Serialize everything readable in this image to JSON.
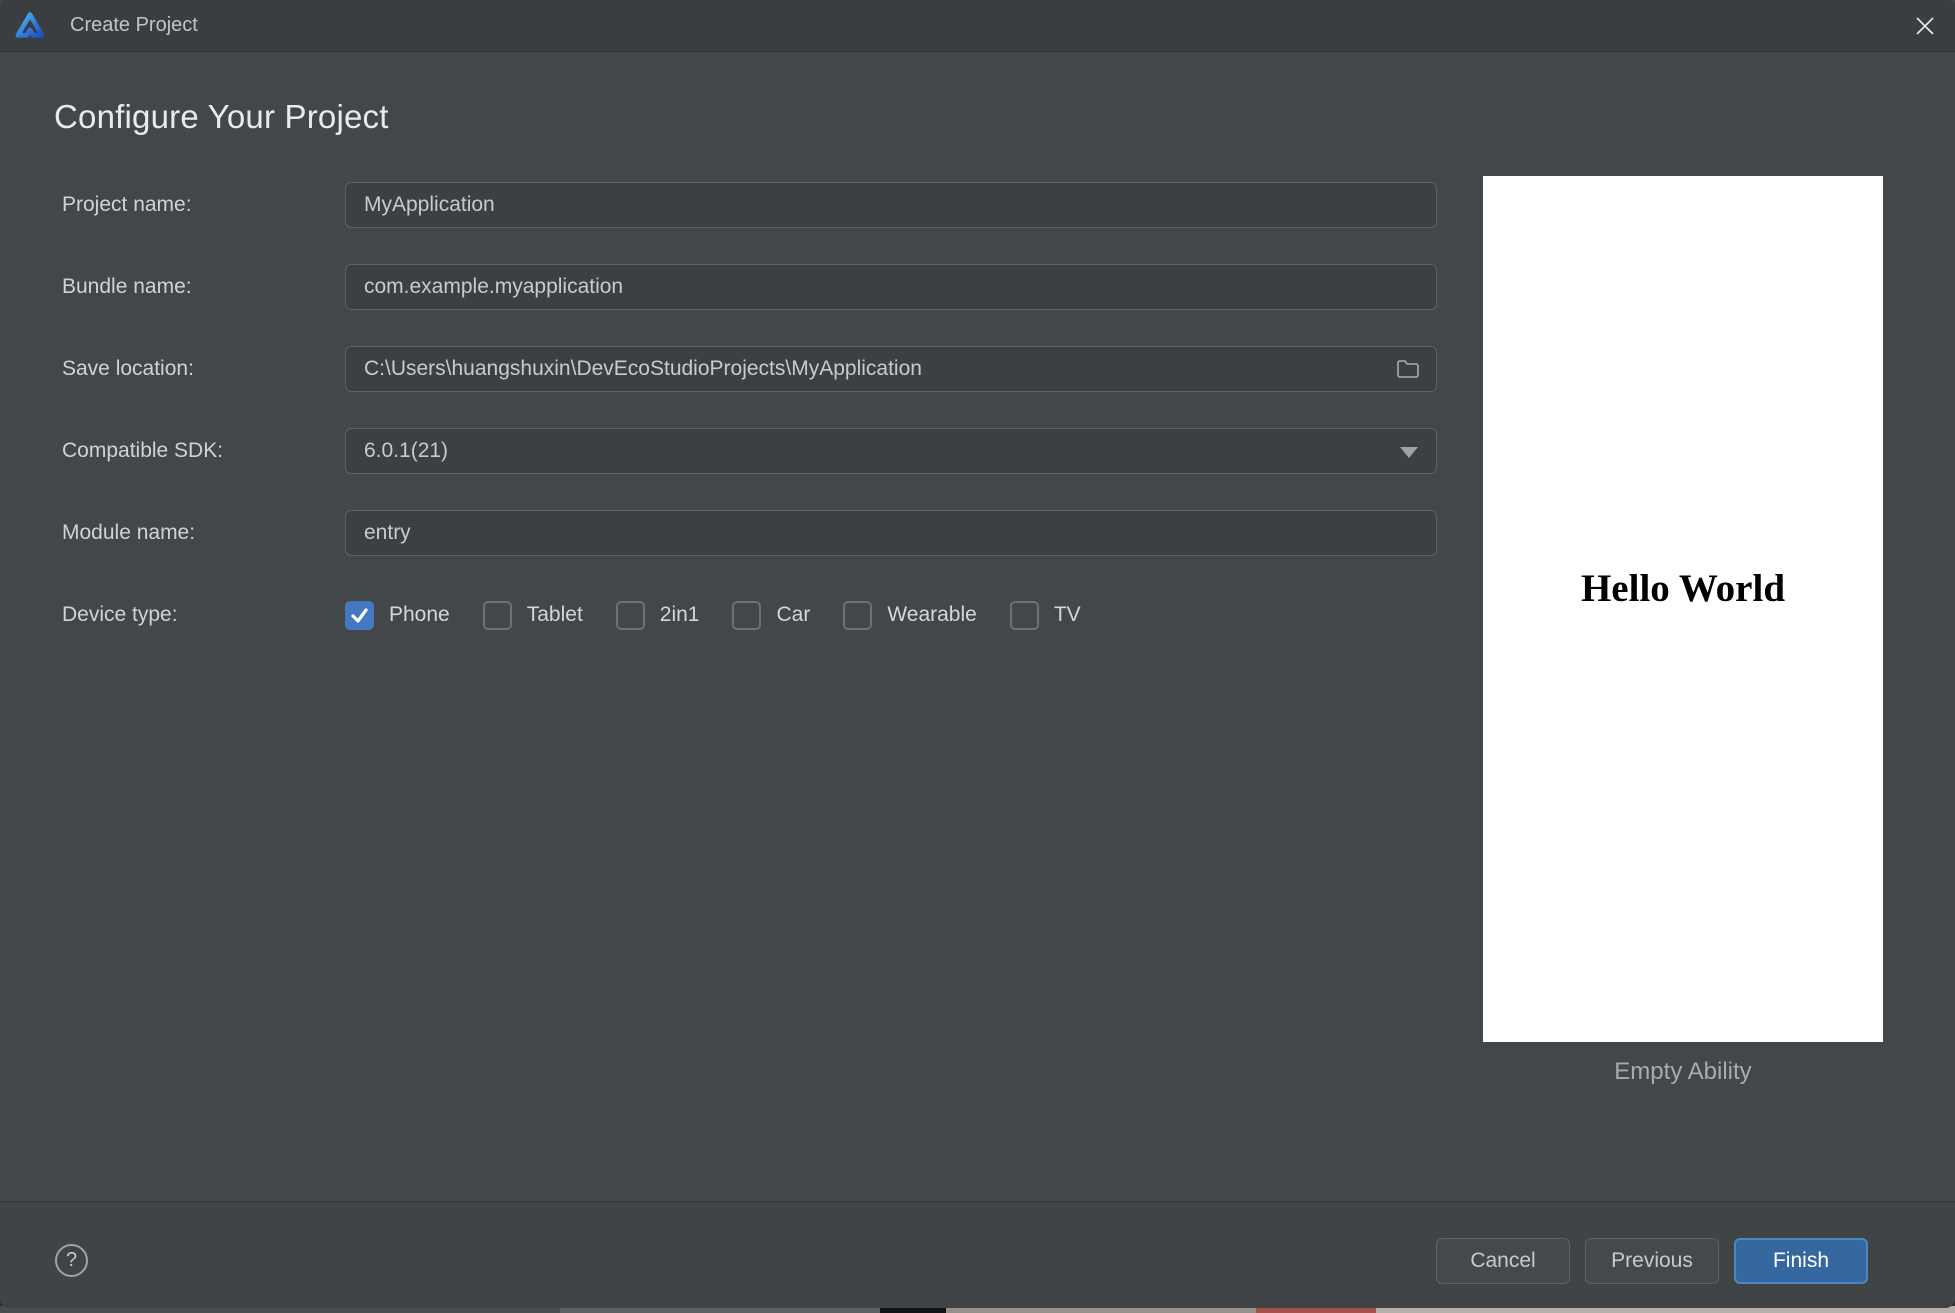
{
  "window": {
    "title": "Create Project",
    "app_logo": "deveco-studio-logo"
  },
  "heading": "Configure Your Project",
  "form": {
    "fields": [
      {
        "label": "Project name:",
        "value": "MyApplication"
      },
      {
        "label": "Bundle name:",
        "value": "com.example.myapplication"
      },
      {
        "label": "Save location:",
        "value": "C:\\Users\\huangshuxin\\DevEcoStudioProjects\\MyApplication"
      },
      {
        "label": "Compatible SDK:",
        "value": "6.0.1(21)"
      },
      {
        "label": "Module name:",
        "value": "entry"
      }
    ],
    "device_type": {
      "label": "Device type:",
      "options": [
        {
          "label": "Phone",
          "checked": true
        },
        {
          "label": "Tablet",
          "checked": false
        },
        {
          "label": "2in1",
          "checked": false
        },
        {
          "label": "Car",
          "checked": false
        },
        {
          "label": "Wearable",
          "checked": false
        },
        {
          "label": "TV",
          "checked": false
        }
      ]
    }
  },
  "preview": {
    "content_text": "Hello World",
    "caption": "Empty Ability"
  },
  "footer": {
    "help_label": "?",
    "buttons": [
      {
        "label": "Cancel",
        "style": "secondary"
      },
      {
        "label": "Previous",
        "style": "secondary"
      },
      {
        "label": "Finish",
        "style": "primary"
      }
    ]
  },
  "colors": {
    "titlebar_bg": "#3b3e40",
    "content_bg": "#434749",
    "field_bg": "#3d4043",
    "field_border": "#5d6163",
    "accent_checkbox": "#4677c1",
    "finish_bg": "#35689f",
    "finish_border": "#4e86be",
    "preview_bg": "#ffffff"
  }
}
